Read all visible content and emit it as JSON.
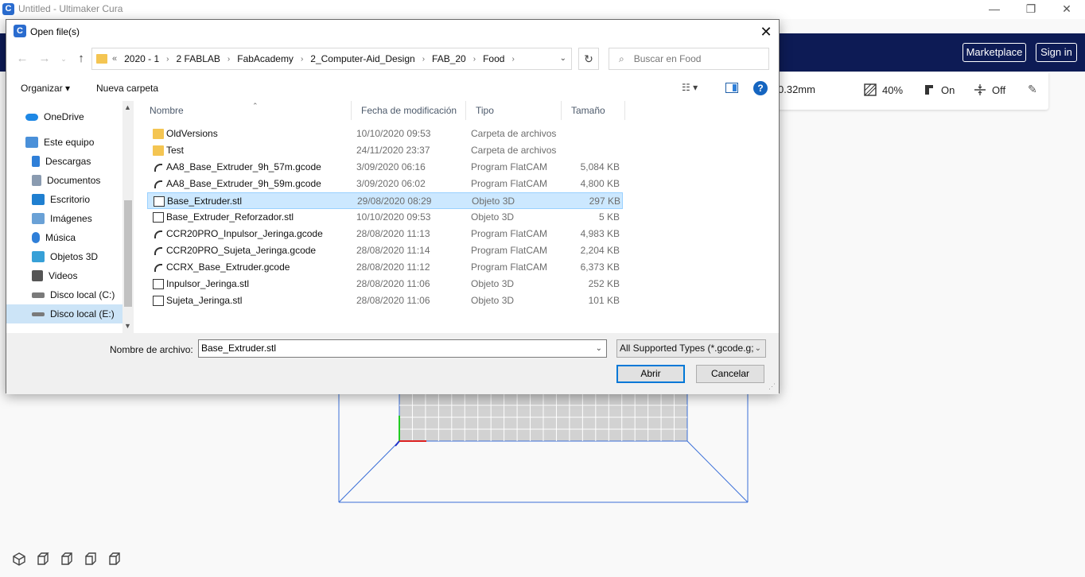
{
  "app": {
    "title": "Untitled - Ultimaker Cura",
    "window_controls": {
      "minimize": "—",
      "maximize": "❐",
      "close": "✕"
    }
  },
  "header": {
    "marketplace": "Marketplace",
    "signin": "Sign in"
  },
  "print_settings": {
    "layer_height": "0.32mm",
    "infill": "40%",
    "support": "On",
    "adhesion": "Off"
  },
  "dialog": {
    "title": "Open file(s)",
    "close": "✕",
    "breadcrumb_lead": "«",
    "breadcrumbs": [
      "2020 - 1",
      "2 FABLAB",
      "FabAcademy",
      "2_Computer-Aid_Design",
      "FAB_20",
      "Food"
    ],
    "search_placeholder": "Buscar en Food",
    "toolbar": {
      "organize": "Organizar ▾",
      "new_folder": "Nueva carpeta"
    },
    "nav_items": [
      {
        "label": "OneDrive",
        "icon": "cloud-icon",
        "color": "#1e88e5"
      },
      {
        "label": "Este equipo",
        "icon": "computer-icon",
        "color": "#4a90d9"
      },
      {
        "label": "Descargas",
        "icon": "download-icon",
        "color": "#2f7fd8"
      },
      {
        "label": "Documentos",
        "icon": "document-icon",
        "color": "#8a9bb0"
      },
      {
        "label": "Escritorio",
        "icon": "desktop-icon",
        "color": "#1f7fd0"
      },
      {
        "label": "Imágenes",
        "icon": "image-icon",
        "color": "#6aa1d6"
      },
      {
        "label": "Música",
        "icon": "music-icon",
        "color": "#2f7fd8"
      },
      {
        "label": "Objetos 3D",
        "icon": "3d-objects-icon",
        "color": "#37a0d7"
      },
      {
        "label": "Videos",
        "icon": "video-icon",
        "color": "#555555"
      },
      {
        "label": "Disco local (C:)",
        "icon": "drive-icon",
        "color": "#7a7a7a"
      },
      {
        "label": "Disco local (E:)",
        "icon": "drive-icon",
        "color": "#7a7a7a"
      }
    ],
    "columns": {
      "name": "Nombre",
      "date": "Fecha de modificación",
      "type": "Tipo",
      "size": "Tamaño"
    },
    "files": [
      {
        "name": "OldVersions",
        "date": "10/10/2020 09:53",
        "type": "Carpeta de archivos",
        "size": "",
        "kind": "folder"
      },
      {
        "name": "Test",
        "date": "24/11/2020 23:37",
        "type": "Carpeta de archivos",
        "size": "",
        "kind": "folder"
      },
      {
        "name": "AA8_Base_Extruder_9h_57m.gcode",
        "date": "3/09/2020 06:16",
        "type": "Program FlatCAM",
        "size": "5,084 KB",
        "kind": "gcode"
      },
      {
        "name": "AA8_Base_Extruder_9h_59m.gcode",
        "date": "3/09/2020 06:02",
        "type": "Program FlatCAM",
        "size": "4,800 KB",
        "kind": "gcode"
      },
      {
        "name": "Base_Extruder.stl",
        "date": "29/08/2020 08:29",
        "type": "Objeto 3D",
        "size": "297 KB",
        "kind": "stl"
      },
      {
        "name": "Base_Extruder_Reforzador.stl",
        "date": "10/10/2020 09:53",
        "type": "Objeto 3D",
        "size": "5 KB",
        "kind": "stl"
      },
      {
        "name": "CCR20PRO_Inpulsor_Jeringa.gcode",
        "date": "28/08/2020 11:13",
        "type": "Program FlatCAM",
        "size": "4,983 KB",
        "kind": "gcode"
      },
      {
        "name": "CCR20PRO_Sujeta_Jeringa.gcode",
        "date": "28/08/2020 11:14",
        "type": "Program FlatCAM",
        "size": "2,204 KB",
        "kind": "gcode"
      },
      {
        "name": "CCRX_Base_Extruder.gcode",
        "date": "28/08/2020 11:12",
        "type": "Program FlatCAM",
        "size": "6,373 KB",
        "kind": "gcode"
      },
      {
        "name": "Inpulsor_Jeringa.stl",
        "date": "28/08/2020 11:06",
        "type": "Objeto 3D",
        "size": "252 KB",
        "kind": "stl"
      },
      {
        "name": "Sujeta_Jeringa.stl",
        "date": "28/08/2020 11:06",
        "type": "Objeto 3D",
        "size": "101 KB",
        "kind": "stl"
      }
    ],
    "filename_label": "Nombre de archivo:",
    "filename_value": "Base_Extruder.stl",
    "filetype": "All Supported Types (*.gcode.g;",
    "open_button": "Abrir",
    "cancel_button": "Cancelar"
  },
  "colors": {
    "header_bg": "#0d1b55",
    "selection": "#cce8ff",
    "accent": "#0078d7"
  }
}
